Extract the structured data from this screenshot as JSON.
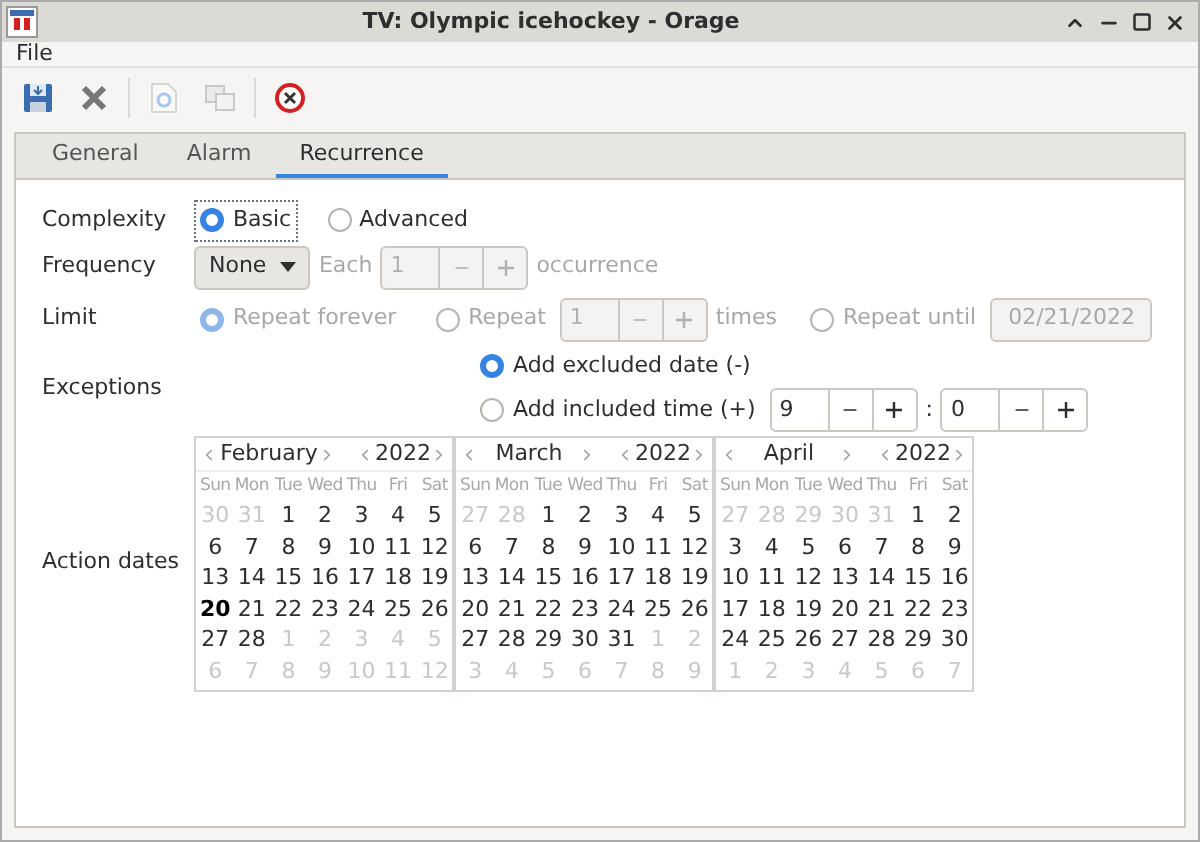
{
  "window": {
    "title": "TV: Olympic icehockey - Orage"
  },
  "menu": [
    "File"
  ],
  "toolbar": [
    {
      "kind": "save",
      "disabled": false
    },
    {
      "kind": "delete",
      "disabled": false
    },
    {
      "kind": "duplicate",
      "disabled": true
    },
    {
      "kind": "copy",
      "disabled": true
    },
    {
      "kind": "close",
      "disabled": false
    }
  ],
  "tabs": [
    {
      "label": "General",
      "selected": false
    },
    {
      "label": "Alarm",
      "selected": false
    },
    {
      "label": "Recurrence",
      "selected": true
    }
  ],
  "complexity": {
    "label": "Complexity",
    "options": [
      {
        "label": "Basic",
        "selected": true
      },
      {
        "label": "Advanced",
        "selected": false
      }
    ]
  },
  "frequency": {
    "label": "Frequency",
    "value": "None",
    "each_label": "Each",
    "each_value": "1",
    "unit": "occurrence",
    "disabled": true
  },
  "limit": {
    "label": "Limit",
    "disabled": true,
    "options": [
      {
        "kind": "plain",
        "label": "Repeat forever",
        "selected": true
      },
      {
        "kind": "count",
        "label": "Repeat",
        "value": "1",
        "unit": "times",
        "selected": false
      },
      {
        "kind": "date",
        "label": "Repeat until",
        "value": "02/21/2022",
        "selected": false
      }
    ]
  },
  "exceptions": {
    "label": "Exceptions",
    "options": [
      {
        "label": "Add excluded date (-)",
        "selected": true
      },
      {
        "label": "Add included time (+)",
        "selected": false
      }
    ],
    "hour": "9",
    "separator": ":",
    "minute": "0"
  },
  "action_dates": {
    "label": "Action dates",
    "calendars": [
      {
        "month": "February",
        "year": "2022",
        "weekdays": [
          "Sun",
          "Mon",
          "Tue",
          "Wed",
          "Thu",
          "Fri",
          "Sat"
        ],
        "before": [
          "30",
          "31"
        ],
        "after": [
          "1",
          "2",
          "3",
          "4",
          "5",
          "6",
          "7",
          "8",
          "9",
          "10",
          "11",
          "12"
        ],
        "days": [
          {
            "d": "1",
            "marked": false
          },
          {
            "d": "2",
            "marked": false
          },
          {
            "d": "3",
            "marked": false
          },
          {
            "d": "4",
            "marked": false
          },
          {
            "d": "5",
            "marked": false
          },
          {
            "d": "6",
            "marked": false
          },
          {
            "d": "7",
            "marked": false
          },
          {
            "d": "8",
            "marked": false
          },
          {
            "d": "9",
            "marked": false
          },
          {
            "d": "10",
            "marked": false
          },
          {
            "d": "11",
            "marked": false
          },
          {
            "d": "12",
            "marked": false
          },
          {
            "d": "13",
            "marked": false
          },
          {
            "d": "14",
            "marked": false
          },
          {
            "d": "15",
            "marked": false
          },
          {
            "d": "16",
            "marked": false
          },
          {
            "d": "17",
            "marked": false
          },
          {
            "d": "18",
            "marked": false
          },
          {
            "d": "19",
            "marked": false
          },
          {
            "d": "20",
            "marked": true
          },
          {
            "d": "21",
            "marked": false
          },
          {
            "d": "22",
            "marked": false
          },
          {
            "d": "23",
            "marked": false
          },
          {
            "d": "24",
            "marked": false
          },
          {
            "d": "25",
            "marked": false
          },
          {
            "d": "26",
            "marked": false
          },
          {
            "d": "27",
            "marked": false
          },
          {
            "d": "28",
            "marked": false
          }
        ]
      },
      {
        "month": "March",
        "year": "2022",
        "weekdays": [
          "Sun",
          "Mon",
          "Tue",
          "Wed",
          "Thu",
          "Fri",
          "Sat"
        ],
        "before": [
          "27",
          "28"
        ],
        "after": [
          "1",
          "2",
          "3",
          "4",
          "5",
          "6",
          "7",
          "8",
          "9"
        ],
        "days": [
          {
            "d": "1",
            "marked": false
          },
          {
            "d": "2",
            "marked": false
          },
          {
            "d": "3",
            "marked": false
          },
          {
            "d": "4",
            "marked": false
          },
          {
            "d": "5",
            "marked": false
          },
          {
            "d": "6",
            "marked": false
          },
          {
            "d": "7",
            "marked": false
          },
          {
            "d": "8",
            "marked": false
          },
          {
            "d": "9",
            "marked": false
          },
          {
            "d": "10",
            "marked": false
          },
          {
            "d": "11",
            "marked": false
          },
          {
            "d": "12",
            "marked": false
          },
          {
            "d": "13",
            "marked": false
          },
          {
            "d": "14",
            "marked": false
          },
          {
            "d": "15",
            "marked": false
          },
          {
            "d": "16",
            "marked": false
          },
          {
            "d": "17",
            "marked": false
          },
          {
            "d": "18",
            "marked": false
          },
          {
            "d": "19",
            "marked": false
          },
          {
            "d": "20",
            "marked": false
          },
          {
            "d": "21",
            "marked": false
          },
          {
            "d": "22",
            "marked": false
          },
          {
            "d": "23",
            "marked": false
          },
          {
            "d": "24",
            "marked": false
          },
          {
            "d": "25",
            "marked": false
          },
          {
            "d": "26",
            "marked": false
          },
          {
            "d": "27",
            "marked": false
          },
          {
            "d": "28",
            "marked": false
          },
          {
            "d": "29",
            "marked": false
          },
          {
            "d": "30",
            "marked": false
          },
          {
            "d": "31",
            "marked": false
          }
        ]
      },
      {
        "month": "April",
        "year": "2022",
        "weekdays": [
          "Sun",
          "Mon",
          "Tue",
          "Wed",
          "Thu",
          "Fri",
          "Sat"
        ],
        "before": [
          "27",
          "28",
          "29",
          "30",
          "31"
        ],
        "after": [
          "1",
          "2",
          "3",
          "4",
          "5",
          "6",
          "7"
        ],
        "days": [
          {
            "d": "1",
            "marked": false
          },
          {
            "d": "2",
            "marked": false
          },
          {
            "d": "3",
            "marked": false
          },
          {
            "d": "4",
            "marked": false
          },
          {
            "d": "5",
            "marked": false
          },
          {
            "d": "6",
            "marked": false
          },
          {
            "d": "7",
            "marked": false
          },
          {
            "d": "8",
            "marked": false
          },
          {
            "d": "9",
            "marked": false
          },
          {
            "d": "10",
            "marked": false
          },
          {
            "d": "11",
            "marked": false
          },
          {
            "d": "12",
            "marked": false
          },
          {
            "d": "13",
            "marked": false
          },
          {
            "d": "14",
            "marked": false
          },
          {
            "d": "15",
            "marked": false
          },
          {
            "d": "16",
            "marked": false
          },
          {
            "d": "17",
            "marked": false
          },
          {
            "d": "18",
            "marked": false
          },
          {
            "d": "19",
            "marked": false
          },
          {
            "d": "20",
            "marked": false
          },
          {
            "d": "21",
            "marked": false
          },
          {
            "d": "22",
            "marked": false
          },
          {
            "d": "23",
            "marked": false
          },
          {
            "d": "24",
            "marked": false
          },
          {
            "d": "25",
            "marked": false
          },
          {
            "d": "26",
            "marked": false
          },
          {
            "d": "27",
            "marked": false
          },
          {
            "d": "28",
            "marked": false
          },
          {
            "d": "29",
            "marked": false
          },
          {
            "d": "30",
            "marked": false
          }
        ]
      }
    ]
  }
}
